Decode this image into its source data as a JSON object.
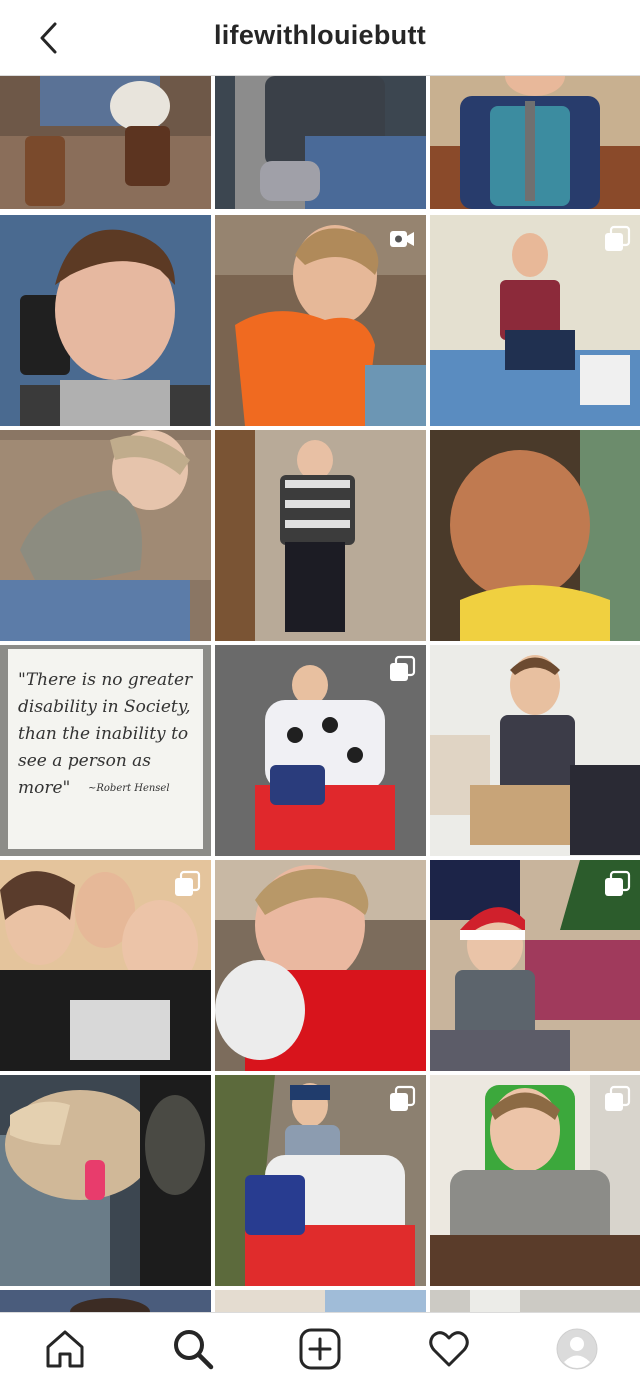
{
  "header": {
    "title": "lifewithlouiebutt",
    "back_icon": "chevron-left-icon"
  },
  "posts": [
    {
      "type": "photo"
    },
    {
      "type": "photo"
    },
    {
      "type": "photo"
    },
    {
      "type": "video"
    },
    {
      "type": "photo"
    },
    {
      "type": "carousel"
    },
    {
      "type": "photo"
    },
    {
      "type": "photo"
    },
    {
      "type": "photo"
    },
    {
      "type": "photo",
      "quote": "\"There is no greater disability in Society, than the inability to see a person as more\"",
      "author": "~Robert Hensel"
    },
    {
      "type": "carousel"
    },
    {
      "type": "photo"
    },
    {
      "type": "carousel"
    },
    {
      "type": "photo"
    },
    {
      "type": "carousel"
    },
    {
      "type": "photo"
    },
    {
      "type": "carousel"
    },
    {
      "type": "carousel"
    }
  ],
  "tabbar": {
    "items": [
      {
        "name": "home",
        "icon": "home-icon"
      },
      {
        "name": "search",
        "icon": "search-icon",
        "active": true
      },
      {
        "name": "new-post",
        "icon": "plus-square-icon"
      },
      {
        "name": "activity",
        "icon": "heart-icon"
      },
      {
        "name": "profile",
        "icon": "avatar-icon"
      }
    ]
  },
  "colors": {
    "text": "#262626",
    "divider": "#dbdbdb",
    "background": "#ffffff"
  }
}
